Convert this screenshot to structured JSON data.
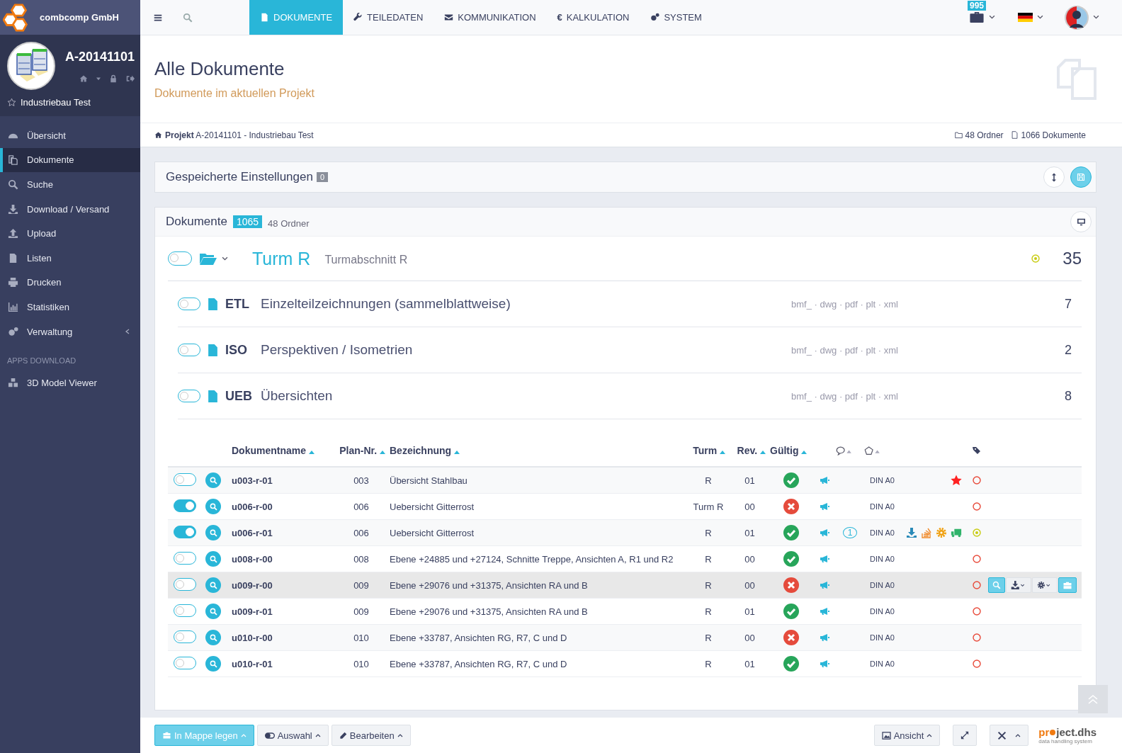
{
  "brand": {
    "name": "combcomp GmbH"
  },
  "project": {
    "code": "A-20141101",
    "name": "Industriebau Test"
  },
  "sidebar": {
    "items": [
      {
        "label": "Übersicht",
        "selected": false
      },
      {
        "label": "Dokumente",
        "selected": true
      },
      {
        "label": "Suche",
        "selected": false
      },
      {
        "label": "Download / Versand",
        "selected": false
      },
      {
        "label": "Upload",
        "selected": false
      },
      {
        "label": "Listen",
        "selected": false
      },
      {
        "label": "Drucken",
        "selected": false
      },
      {
        "label": "Statistiken",
        "selected": false
      },
      {
        "label": "Verwaltung",
        "selected": false,
        "expandable": true
      }
    ],
    "section": "APPS DOWNLOAD",
    "apps": [
      {
        "label": "3D Model Viewer",
        "selected": false
      }
    ]
  },
  "topnav": {
    "tabs": [
      {
        "label": "DOKUMENTE",
        "selected": true
      },
      {
        "label": "TEILEDATEN",
        "selected": false
      },
      {
        "label": "KOMMUNIKATION",
        "selected": false
      },
      {
        "label": "KALKULATION",
        "selected": false,
        "glyph": "€"
      },
      {
        "label": "SYSTEM",
        "selected": false
      }
    ],
    "badge": "995"
  },
  "page": {
    "title": "Alle Dokumente",
    "subtitle": "Dokumente im aktuellen Projekt"
  },
  "breadcrumb": {
    "text": "**Projekt** A-20141101 - Industriebau Test",
    "folders": "48 Ordner",
    "documents": "1066 Dokumente"
  },
  "saved": {
    "title": "Gespeicherte Einstellungen",
    "count": "0"
  },
  "documents": {
    "title": "Dokumente",
    "count": "1065",
    "folders": "48 Ordner",
    "folder": {
      "name": "Turm R",
      "description": "Turmabschnitt R",
      "count": "35",
      "on": false
    },
    "subfolders": [
      {
        "code": "ETL",
        "name": "Einzelteilzeichnungen (sammelblattweise)",
        "formats": "bmf_ · dwg · pdf · plt · xml",
        "count": "7",
        "on": false
      },
      {
        "code": "ISO",
        "name": "Perspektiven / Isometrien",
        "formats": "bmf_ · dwg · pdf · plt · xml",
        "count": "2",
        "on": false
      },
      {
        "code": "UEB",
        "name": "Übersichten",
        "formats": "bmf_ · dwg · pdf · plt · xml",
        "count": "8",
        "on": false
      }
    ],
    "table": {
      "columns": [
        "Dokumentname",
        "Plan-Nr.",
        "Bezeichnung",
        "Turm",
        "Rev.",
        "Gültig"
      ],
      "rows": [
        {
          "on": false,
          "extras": false,
          "name": "u003-r-01",
          "plan": "003",
          "title": "Übersicht Stahlbau",
          "tower": "R",
          "rev": "01",
          "valid": true,
          "format": "DIN A0",
          "starred": true,
          "marked": false,
          "selected": false
        },
        {
          "on": true,
          "extras": false,
          "name": "u006-r-00",
          "plan": "006",
          "title": "Uebersicht Gitterrost",
          "tower": "Turm R",
          "rev": "00",
          "valid": false,
          "format": "DIN A0",
          "starred": false,
          "marked": false,
          "selected": false
        },
        {
          "on": true,
          "name": "u006-r-01",
          "plan": "006",
          "title": "Uebersicht Gitterrost",
          "tower": "R",
          "rev": "01",
          "valid": true,
          "comments": "1",
          "format": "DIN A0",
          "starred": false,
          "extras": true,
          "marked": true,
          "selected": false
        },
        {
          "on": false,
          "extras": false,
          "name": "u008-r-00",
          "plan": "008",
          "title": "Ebene +24885 und +27124, Schnitte Treppe, Ansichten A, R1 und R2",
          "tower": "R",
          "rev": "00",
          "valid": true,
          "format": "DIN A0",
          "starred": false,
          "marked": false,
          "selected": false
        },
        {
          "on": false,
          "extras": false,
          "name": "u009-r-00",
          "plan": "009",
          "title": "Ebene +29076 und +31375, Ansichten RA und B",
          "tower": "R",
          "rev": "00",
          "valid": false,
          "format": "DIN A0",
          "starred": false,
          "marked": false,
          "selected": true
        },
        {
          "on": false,
          "extras": false,
          "name": "u009-r-01",
          "plan": "009",
          "title": "Ebene +29076 und +31375, Ansichten RA und B",
          "tower": "R",
          "rev": "01",
          "valid": true,
          "format": "DIN A0",
          "starred": false,
          "marked": false,
          "selected": false
        },
        {
          "on": false,
          "extras": false,
          "name": "u010-r-00",
          "plan": "010",
          "title": "Ebene +33787, Ansichten RG, R7, C und D",
          "tower": "R",
          "rev": "00",
          "valid": false,
          "format": "DIN A0",
          "starred": false,
          "marked": false,
          "selected": false
        },
        {
          "on": false,
          "extras": false,
          "name": "u010-r-01",
          "plan": "010",
          "title": "Ebene +33787, Ansichten RG, R7, C und D",
          "tower": "R",
          "rev": "01",
          "valid": true,
          "format": "DIN A0",
          "starred": false,
          "marked": false,
          "selected": false
        }
      ]
    }
  },
  "footer": {
    "left": [
      "In Mappe legen",
      "Auswahl",
      "Bearbeiten"
    ],
    "view": "Ansicht",
    "logo": {
      "pre": "pr",
      "post": "ject.dhs",
      "tagline": "data handling system"
    }
  }
}
